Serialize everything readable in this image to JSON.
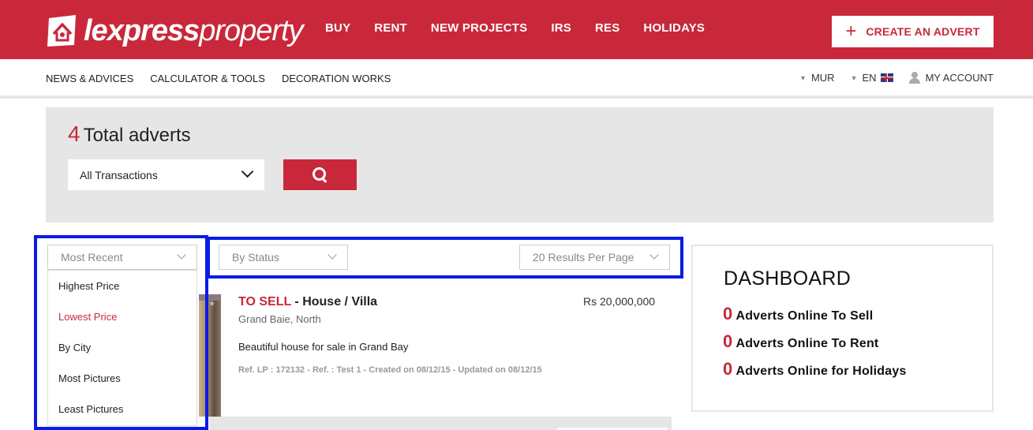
{
  "brand": {
    "logo_bold": "lexpress",
    "logo_thin": "property",
    "accent_color": "#c9283a"
  },
  "main_nav": [
    "BUY",
    "RENT",
    "NEW PROJECTS",
    "IRS",
    "RES",
    "HOLIDAYS"
  ],
  "create_advert": {
    "icon": "plus-icon",
    "label": "CREATE AN ADVERT"
  },
  "sub_nav": [
    "NEWS & ADVICES",
    "CALCULATOR & TOOLS",
    "DECORATION WORKS"
  ],
  "account_bar": {
    "currency": "MUR",
    "language": "EN",
    "account": "MY ACCOUNT"
  },
  "search": {
    "total_count": "4",
    "total_label": "Total adverts",
    "transaction_value": "All Transactions",
    "search_icon": "search-icon"
  },
  "filters": {
    "sort_value": "Most Recent",
    "status_value": "By Status",
    "per_page_value": "20 Results Per Page",
    "sort_options": [
      "Highest Price",
      "Lowest Price",
      "By City",
      "Most Pictures",
      "Least Pictures"
    ],
    "sort_active_option": "Lowest Price"
  },
  "listing": {
    "type_label": "TO SELL",
    "type_rest": " - House / Villa",
    "price": "Rs 20,000,000",
    "location": "Grand Baie, North",
    "description": "Beautiful house for sale in Grand Bay",
    "reference": "Ref. LP : 172132 - Ref. : Test 1 - Created on 08/12/15 - Updated on 08/12/15"
  },
  "dashboard": {
    "title": "DASHBOARD",
    "lines": [
      {
        "count": "0",
        "label": "Adverts Online To Sell"
      },
      {
        "count": "0",
        "label": "Adverts Online To Rent"
      },
      {
        "count": "0",
        "label": "Adverts Online for Holidays"
      }
    ]
  }
}
